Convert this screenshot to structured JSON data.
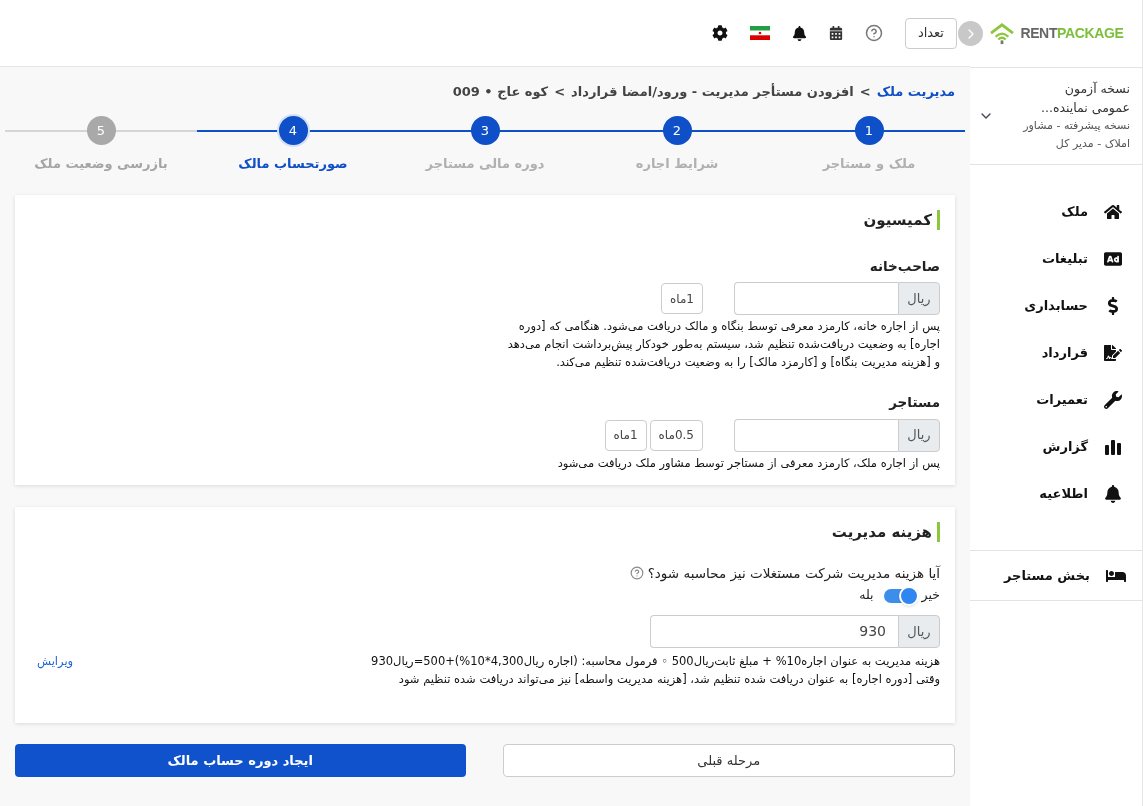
{
  "logo": {
    "part_1": "RENT",
    "part_2": "PACKAGE"
  },
  "account": {
    "line_1": "نسخه آزمون",
    "line_2": "عمومی نماینده...",
    "line_3": "نسخه پیشرفته - مشاور املاک - مدیر کل"
  },
  "sidebar": {
    "items": [
      {
        "label": "ملک",
        "kind": "home"
      },
      {
        "label": "تبلیغات",
        "kind": "ad"
      },
      {
        "label": "حسابداری",
        "kind": "dollar"
      },
      {
        "label": "قرارداد",
        "kind": "contract"
      },
      {
        "label": "تعمیرات",
        "kind": "wrench"
      },
      {
        "label": "گزارش",
        "kind": "chart"
      },
      {
        "label": "اطلاعیه",
        "kind": "bell"
      }
    ],
    "footer_item": {
      "label": "بخش مستاجر"
    }
  },
  "topbar": {
    "count_button": "تعداد"
  },
  "breadcrumb": {
    "link": "مدیریت ملک",
    "separator_1": ">",
    "middle": "افزودن مستأجر مدیریت - ورود/امضا قرارداد",
    "separator_2": ">",
    "current": "کوه عاج • 009"
  },
  "steps": [
    {
      "number": "1",
      "label": "ملک و مستاجر",
      "done": true,
      "selected": false
    },
    {
      "number": "2",
      "label": "شرایط اجاره",
      "done": true,
      "selected": false
    },
    {
      "number": "3",
      "label": "دوره مالی مستاجر",
      "done": true,
      "selected": false
    },
    {
      "number": "4",
      "label": "صورتحساب مالک",
      "done": false,
      "selected": true
    },
    {
      "number": "5",
      "label": "بازرسی وضعیت ملک",
      "done": false,
      "selected": false
    }
  ],
  "commission": {
    "title": "کمیسیون",
    "groups": [
      {
        "label": "صاحب‌خانه",
        "unit": "ریال",
        "chips": [
          "1ماه"
        ],
        "note": "پس از اجاره خانه، کارمزد معرفی توسط بنگاه و مالک دریافت می‌شود. هنگامی که [دوره اجاره] به وضعیت دریافت‌شده تنظیم شد، سیستم به‌طور خودکار پیش‌برداشت انجام می‌دهد و [هزینه مدیریت بنگاه] و [کارمزد مالک] را به وضعیت دریافت‌شده تنظیم می‌کند."
      },
      {
        "label": "مستاجر",
        "unit": "ریال",
        "chips": [
          "0.5ماه",
          "1ماه"
        ],
        "note": "پس از اجاره ملک، کارمزد معرفی از مستاجر توسط مشاور ملک دریافت می‌شود"
      }
    ]
  },
  "management": {
    "title": "هزینه مدیریت",
    "question": "آیا هزینه مدیریت شرکت مستغلات نیز محاسبه شود؟",
    "off_label": "خیر",
    "on_label": "بله",
    "on": true,
    "unit": "ریال",
    "value": "930",
    "formula": "هزینه مدیریت به عنوان اجاره10% + مبلغ ثابت‌ریال500 ◦ فرمول محاسبه: (اجاره ریال4,300*10%)+500=ریال930",
    "edit_link": "ویرایش",
    "note": "وقتی [دوره اجاره] به عنوان دریافت شده تنظیم شد، [هزینه مدیریت واسطه] نیز می‌تواند دریافت شده تنظیم شود"
  },
  "actions": {
    "previous": "مرحله قبلی",
    "submit": "ایجاد دوره حساب مالک"
  }
}
